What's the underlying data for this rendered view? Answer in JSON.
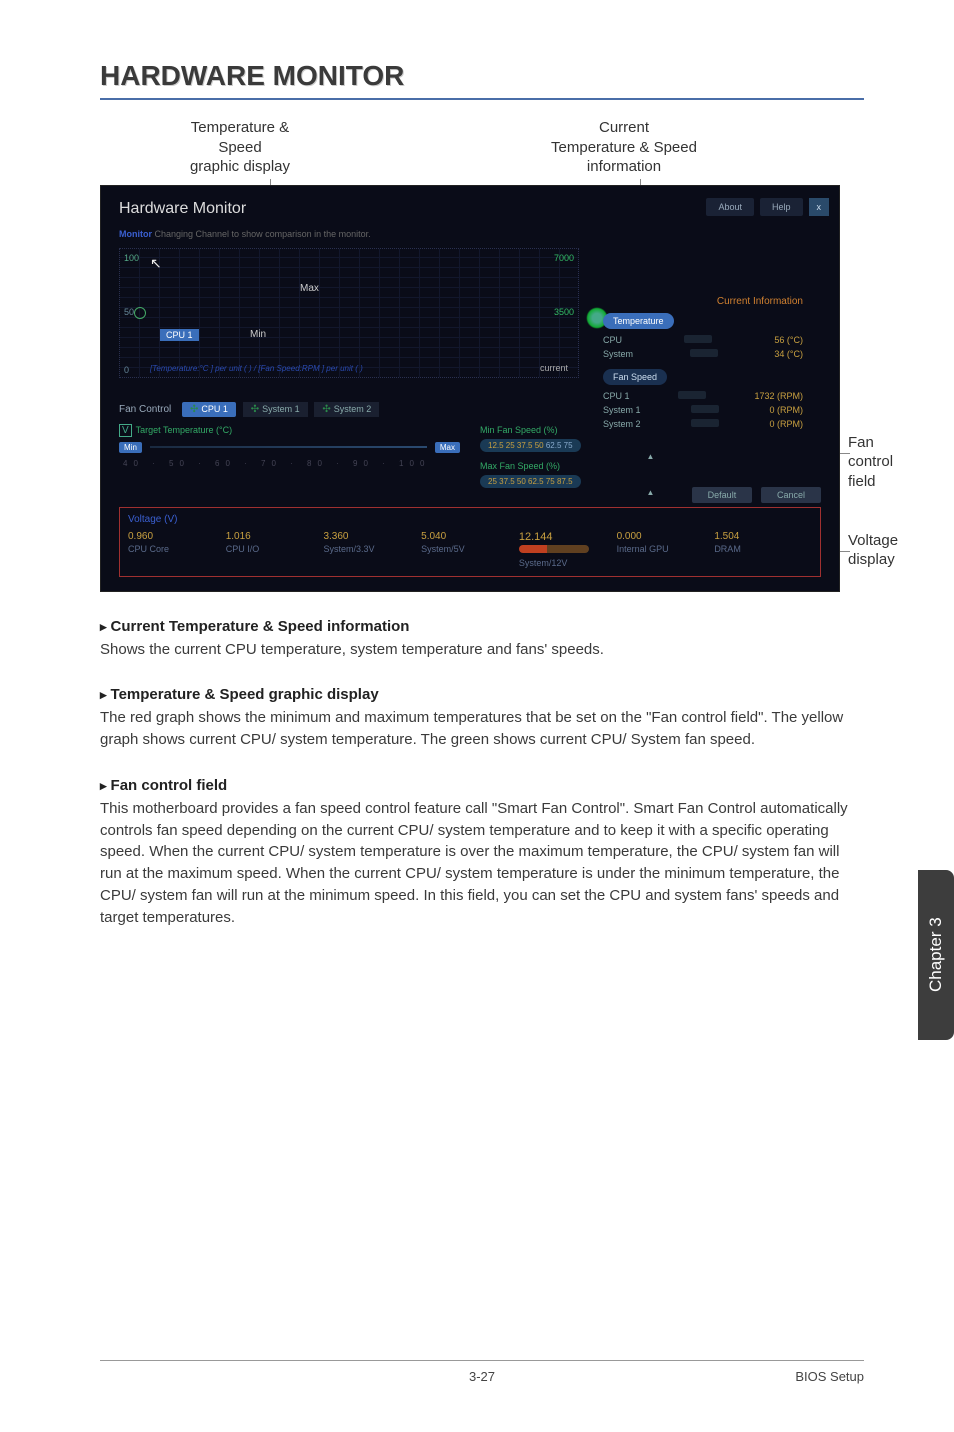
{
  "page": {
    "title": "HARDWARE MONITOR",
    "side_tab": "Chapter 3",
    "footer_page": "3-27",
    "footer_section": "BIOS Setup"
  },
  "top_labels": {
    "left": "Temperature &\nSpeed\ngraphic display",
    "right": "Current\nTemperature & Speed\ninformation"
  },
  "callouts": {
    "fan": "Fan\ncontrol field",
    "voltage": "Voltage\ndisplay"
  },
  "figure": {
    "hw_title": "Hardware Monitor",
    "monitor_prefix": "Monitor",
    "monitor_rest": " Changing Channel to show comparison in the monitor.",
    "about": "About",
    "help": "Help",
    "close": "x",
    "ci_title": "Current Information",
    "graph": {
      "y100": "100",
      "y50": "50",
      "y0": "0",
      "r7000": "7000",
      "r3500": "3500",
      "max": "Max",
      "min": "Min",
      "cpu1": "CPU 1",
      "legend": "[Temperature:°C ] per unit (   ) / [Fan Speed:RPM ] per unit (   )",
      "current": "current"
    },
    "temp": {
      "tab": "Temperature",
      "rows": [
        {
          "name": "CPU",
          "val": "56 (°C)"
        },
        {
          "name": "System",
          "val": "34 (°C)"
        }
      ]
    },
    "fan": {
      "tab": "Fan Speed",
      "rows": [
        {
          "name": "CPU 1",
          "val": "1732 (RPM)"
        },
        {
          "name": "System 1",
          "val": "0 (RPM)"
        },
        {
          "name": "System 2",
          "val": "0 (RPM)"
        }
      ]
    },
    "fc": {
      "label": "Fan Control",
      "tabs": [
        "CPU 1",
        "System 1",
        "System 2"
      ],
      "tt": "Target Temperature (°C)",
      "min_knob": "Min",
      "max_knob": "Max",
      "ticks": "40  ·  50  ·  60  ·  70  ·  80  ·  90  ·  100",
      "min_title": "Min Fan Speed (%)",
      "min_vals": "12.5  25  37.5  50",
      "min_rest": "  62.5  75",
      "max_title": "Max Fan Speed (%)",
      "max_vals": "25  37.5  50  62.5  75  87.5",
      "default": "Default",
      "cancel": "Cancel"
    },
    "voltage": {
      "title": "Voltage (V)",
      "cells": [
        {
          "val": "0.960",
          "lbl": "CPU Core"
        },
        {
          "val": "1.016",
          "lbl": "CPU I/O"
        },
        {
          "val": "3.360",
          "lbl": "System/3.3V"
        },
        {
          "val": "5.040",
          "lbl": "System/5V"
        },
        {
          "val": "12.144",
          "lbl": "System/12V"
        },
        {
          "val": "0.000",
          "lbl": "Internal GPU"
        },
        {
          "val": "1.504",
          "lbl": "DRAM"
        }
      ]
    }
  },
  "sections": [
    {
      "h": "Current Temperature & Speed information",
      "p": "Shows the current CPU temperature, system temperature and fans' speeds."
    },
    {
      "h": "Temperature & Speed graphic display",
      "p": "The red graph shows the minimum and maximum temperatures that be set on the \"Fan control field\".  The yellow graph shows current CPU/ system temperature. The green shows current CPU/ System fan speed."
    },
    {
      "h": "Fan control field",
      "p": "This motherboard provides a fan speed control feature call \"Smart Fan Control\". Smart Fan Control automatically controls fan speed depending on the current CPU/ system temperature and to keep it with a specific operating speed. When the current CPU/ system temperature is over the maximum temperature, the CPU/ system fan will run at the maximum speed. When the current CPU/ system temperature is under the minimum temperature, the CPU/ system fan will run at the minimum speed. In this field, you can set the CPU and system fans' speeds and target temperatures."
    }
  ]
}
